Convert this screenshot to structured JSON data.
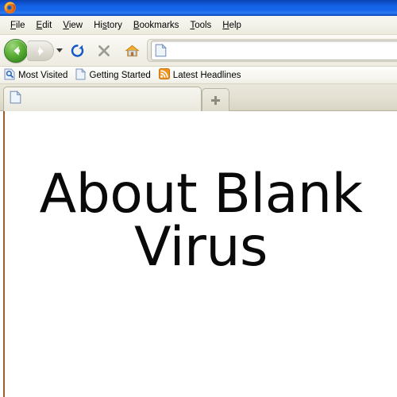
{
  "window": {
    "app_icon": "firefox-logo-icon",
    "title": "",
    "titlebar_color": "#1464e8"
  },
  "menubar": {
    "items": [
      {
        "label": "File",
        "accel": "F"
      },
      {
        "label": "Edit",
        "accel": "E"
      },
      {
        "label": "View",
        "accel": "V"
      },
      {
        "label": "History",
        "accel": "s"
      },
      {
        "label": "Bookmarks",
        "accel": "B"
      },
      {
        "label": "Tools",
        "accel": "T"
      },
      {
        "label": "Help",
        "accel": "H"
      }
    ]
  },
  "navbar": {
    "back": {
      "icon": "back-arrow-icon",
      "enabled": true,
      "color": "#4ea32a"
    },
    "forward": {
      "icon": "forward-arrow-icon",
      "enabled": false,
      "color": "#cfccc2"
    },
    "dropdown": {
      "icon": "chevron-down-icon"
    },
    "reload": {
      "icon": "reload-icon",
      "color": "#1357c8"
    },
    "stop": {
      "icon": "stop-x-icon",
      "color": "#9b9b94"
    },
    "home": {
      "icon": "home-icon",
      "color": "#f0a62a"
    },
    "address": {
      "icon": "page-document-icon",
      "value": "",
      "placeholder": ""
    }
  },
  "bookmarks_bar": {
    "items": [
      {
        "label": "Most Visited",
        "icon": "magnifier-page-icon"
      },
      {
        "label": "Getting Started",
        "icon": "page-document-icon"
      },
      {
        "label": "Latest Headlines",
        "icon": "rss-feed-icon"
      }
    ]
  },
  "tabbar": {
    "active_tab": {
      "label": "",
      "icon": "page-document-icon"
    },
    "new_tab": {
      "icon": "plus-icon",
      "label": "+"
    }
  },
  "content": {
    "heading": "About Blank Virus",
    "background": "#ffffff",
    "left_rule_color": "#9d5d25"
  }
}
